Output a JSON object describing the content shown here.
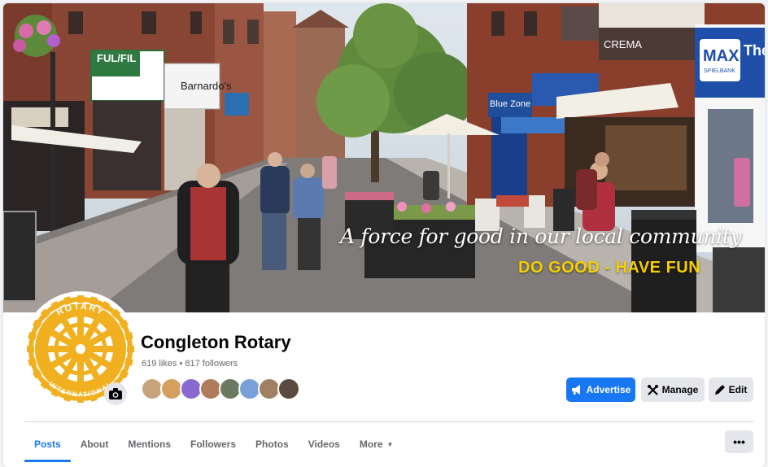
{
  "cover": {
    "tagline": "A force for good in our local community",
    "slogan": "DO GOOD - HAVE FUN",
    "shop_signs": {
      "fulfil": "FUL/FIL",
      "barnardos": "Barnardo's",
      "crema": "CREMA",
      "blue_zone": "Blue Zone",
      "max": "MAX",
      "max_sub": "SPIELBANK",
      "the": "The"
    }
  },
  "profile": {
    "emblem": {
      "top_text": "ROTARY",
      "bottom_text": "INTERNATIONAL",
      "color": "#f0b020"
    }
  },
  "page": {
    "name": "Congleton Rotary",
    "stats": "619 likes • 817 followers"
  },
  "follower_avatars": [
    "#c8a47a",
    "#d4a060",
    "#8a6ad0",
    "#b07b5a",
    "#6a7a60",
    "#7aa0d8",
    "#a08060",
    "#5a4a40"
  ],
  "actions": {
    "advertise": "Advertise",
    "manage": "Manage",
    "edit": "Edit"
  },
  "tabs": [
    {
      "label": "Posts"
    },
    {
      "label": "About"
    },
    {
      "label": "Mentions"
    },
    {
      "label": "Followers"
    },
    {
      "label": "Photos"
    },
    {
      "label": "Videos"
    },
    {
      "label": "More"
    }
  ],
  "more_menu": "•••",
  "colors": {
    "accent": "#1877f2",
    "slogan": "#f5d000",
    "rotary_gold": "#f0b020"
  }
}
